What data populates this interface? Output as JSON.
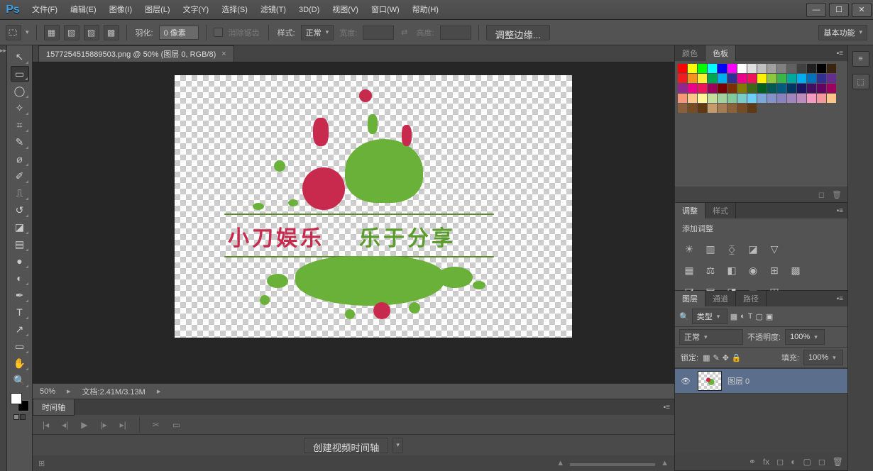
{
  "app": {
    "logo": "Ps"
  },
  "menu": [
    "文件(F)",
    "编辑(E)",
    "图像(I)",
    "图层(L)",
    "文字(Y)",
    "选择(S)",
    "滤镜(T)",
    "3D(D)",
    "视图(V)",
    "窗口(W)",
    "帮助(H)"
  ],
  "window_controls": {
    "min": "—",
    "max": "☐",
    "close": "✕"
  },
  "optionbar": {
    "feather_label": "羽化:",
    "feather_value": "0 像素",
    "antialias": "消除锯齿",
    "style_label": "样式:",
    "style_value": "正常",
    "width_label": "宽度:",
    "height_label": "高度:",
    "refine_edge": "调整边缘...",
    "workspace": "基本功能"
  },
  "tools": [
    {
      "name": "move-tool",
      "glyph": "↖"
    },
    {
      "name": "marquee-tool",
      "glyph": "▭",
      "selected": true
    },
    {
      "name": "lasso-tool",
      "glyph": "◯"
    },
    {
      "name": "magic-wand-tool",
      "glyph": "✧"
    },
    {
      "name": "crop-tool",
      "glyph": "⌗"
    },
    {
      "name": "eyedropper-tool",
      "glyph": "✎"
    },
    {
      "name": "healing-brush-tool",
      "glyph": "⌀"
    },
    {
      "name": "brush-tool",
      "glyph": "✐"
    },
    {
      "name": "clone-stamp-tool",
      "glyph": "⎍"
    },
    {
      "name": "history-brush-tool",
      "glyph": "↺"
    },
    {
      "name": "eraser-tool",
      "glyph": "◪"
    },
    {
      "name": "gradient-tool",
      "glyph": "▤"
    },
    {
      "name": "blur-tool",
      "glyph": "●"
    },
    {
      "name": "dodge-tool",
      "glyph": "◐"
    },
    {
      "name": "pen-tool",
      "glyph": "✒"
    },
    {
      "name": "type-tool",
      "glyph": "T"
    },
    {
      "name": "path-selection-tool",
      "glyph": "↗"
    },
    {
      "name": "shape-tool",
      "glyph": "▭"
    },
    {
      "name": "hand-tool",
      "glyph": "✋"
    },
    {
      "name": "zoom-tool",
      "glyph": "🔍"
    }
  ],
  "document": {
    "tab_title": "1577254515889503.png @ 50% (图层 0, RGB/8)",
    "zoom": "50%",
    "doc_info": "文档:2.41M/3.13M",
    "art_text1": "小刀娱乐",
    "art_text2": "乐于分享"
  },
  "timeline": {
    "tab": "时间轴",
    "create_btn": "创建视频时间轴"
  },
  "panels": {
    "color": {
      "tabs": [
        "颜色",
        "色板"
      ],
      "active": 1
    },
    "adjust": {
      "tabs": [
        "调整",
        "样式"
      ],
      "active": 0,
      "add_label": "添加调整"
    },
    "layers": {
      "tabs": [
        "图层",
        "通道",
        "路径"
      ],
      "active": 0,
      "kind_label": "类型",
      "blend_mode": "正常",
      "opacity_label": "不透明度:",
      "opacity_value": "100%",
      "lock_label": "锁定:",
      "fill_label": "填充:",
      "fill_value": "100%",
      "layer_name": "图层 0"
    }
  },
  "swatch_colors": [
    "#ff0000",
    "#ffff00",
    "#00ff00",
    "#00ffff",
    "#0000ff",
    "#ff00ff",
    "#ffffff",
    "#e0e0e0",
    "#c0c0c0",
    "#a0a0a0",
    "#808080",
    "#606060",
    "#404040",
    "#202020",
    "#000000",
    "#3a240f",
    "#ee1d23",
    "#f6921e",
    "#fdef34",
    "#00a551",
    "#00adef",
    "#2f3192",
    "#ec008c",
    "#ed145b",
    "#fff200",
    "#8dc63f",
    "#39b54a",
    "#00a99d",
    "#00aeef",
    "#0072bc",
    "#2e3192",
    "#662d91",
    "#92278f",
    "#ec008c",
    "#ed145b",
    "#9e005d",
    "#790000",
    "#7b2e00",
    "#827b00",
    "#406618",
    "#005e20",
    "#005952",
    "#005b7f",
    "#003663",
    "#1b1464",
    "#440e62",
    "#630460",
    "#9e005d",
    "#f7977a",
    "#fdc68a",
    "#fff79a",
    "#c4df9b",
    "#a3d39c",
    "#82ca9c",
    "#7accc8",
    "#6dcff6",
    "#7da7d9",
    "#8393ca",
    "#8882be",
    "#a186be",
    "#bc8cbf",
    "#f49ac1",
    "#f5989d",
    "#fdc689",
    "#8b5e3c",
    "#754c24",
    "#603913",
    "#c69c6d",
    "#a67c52",
    "#8c6239",
    "#754c24",
    "#603913"
  ]
}
